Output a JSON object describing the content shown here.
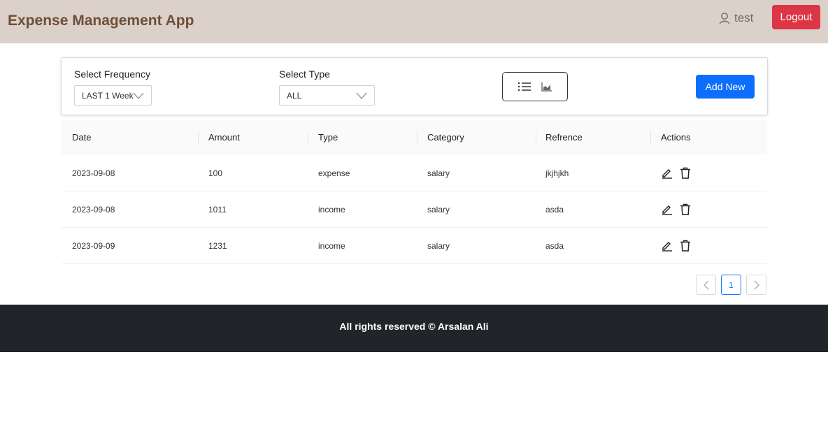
{
  "header": {
    "title": "Expense Management App",
    "user_name": "test",
    "logout_label": "Logout"
  },
  "filters": {
    "frequency_label": "Select Frequency",
    "frequency_value": "LAST 1 Week",
    "type_label": "Select Type",
    "type_value": "ALL",
    "add_new_label": "Add New"
  },
  "table": {
    "columns": [
      "Date",
      "Amount",
      "Type",
      "Category",
      "Refrence",
      "Actions"
    ],
    "rows": [
      {
        "date": "2023-09-08",
        "amount": "100",
        "type": "expense",
        "category": "salary",
        "reference": "jkjhjkh"
      },
      {
        "date": "2023-09-08",
        "amount": "1011",
        "type": "income",
        "category": "salary",
        "reference": "asda"
      },
      {
        "date": "2023-09-09",
        "amount": "1231",
        "type": "income",
        "category": "salary",
        "reference": "asda"
      }
    ]
  },
  "pagination": {
    "current_page": "1"
  },
  "footer": {
    "text": "All rights reserved © Arsalan Ali"
  },
  "colors": {
    "navbar_bg": "#dcd1ca",
    "brand": "#6f4e37",
    "logout": "#dc3545",
    "primary": "#0d6efd",
    "footer_bg": "#212529"
  }
}
